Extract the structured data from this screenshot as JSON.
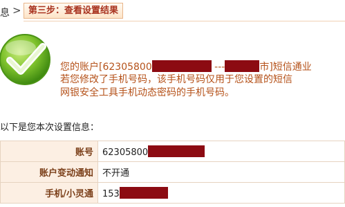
{
  "breadcrumb": {
    "prev_label": "息",
    "separator": ">",
    "current_step": "第三步：查看设置结果"
  },
  "message": {
    "line1_prefix": "您的账户[",
    "line1_account": "62305800",
    "line1_middle": " ---",
    "line1_suffix": "市]短信通业",
    "line2_a": "若您修改了手机号码，该手机号码仅用",
    "line2_b": "于您设置的短信",
    "line3": "网银安全工具手机动态密码的手机号码。"
  },
  "intro_text": "以下是您本次设置信息：",
  "settings_table": [
    {
      "label": "账号",
      "value": "62305800"
    },
    {
      "label": "账户变动通知",
      "value": "不开通"
    },
    {
      "label": "手机/小灵通",
      "value": "153"
    }
  ],
  "colors": {
    "accent_text": "#b5521a",
    "redaction": "#8c0b12",
    "check_green": "#5fae1c"
  }
}
